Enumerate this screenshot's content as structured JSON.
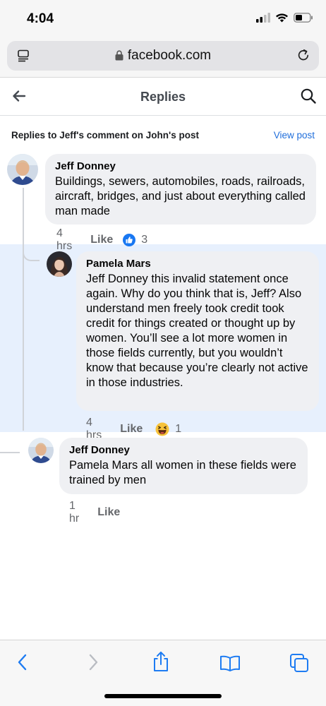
{
  "status_bar": {
    "time": "4:04"
  },
  "browser": {
    "url": "facebook.com"
  },
  "header": {
    "title": "Replies"
  },
  "context": {
    "text": "Replies to Jeff's comment on John's post",
    "view_post": "View post"
  },
  "comments": [
    {
      "author": "Jeff Donney",
      "text": "Buildings, sewers, automobiles, roads, railroads, aircraft, bridges, and just about everything called man made",
      "time": "4 hrs",
      "like": "Like",
      "reaction": "like-icon",
      "reaction_count": "3"
    },
    {
      "author": "Pamela Mars",
      "text": "Jeff Donney this invalid statement once again. Why do you think that is, Jeff? Also understand men freely took credit took credit for things created or thought up by women. You’ll see a lot more women in those fields currently, but you wouldn’t know that because you’re clearly not active in those industries.",
      "time": "4 hrs",
      "like": "Like",
      "reaction": "haha-icon",
      "reaction_count": "1"
    },
    {
      "author": "Jeff Donney",
      "text": "Pamela Mars all women in these fields were trained by men",
      "time": "1 hr",
      "like": "Like"
    }
  ],
  "colors": {
    "accent": "#216fdb",
    "like_blue": "#1877f2",
    "highlight": "#e7f0fd",
    "bubble": "#eff0f3",
    "ios_blue": "#1e7cf2"
  }
}
